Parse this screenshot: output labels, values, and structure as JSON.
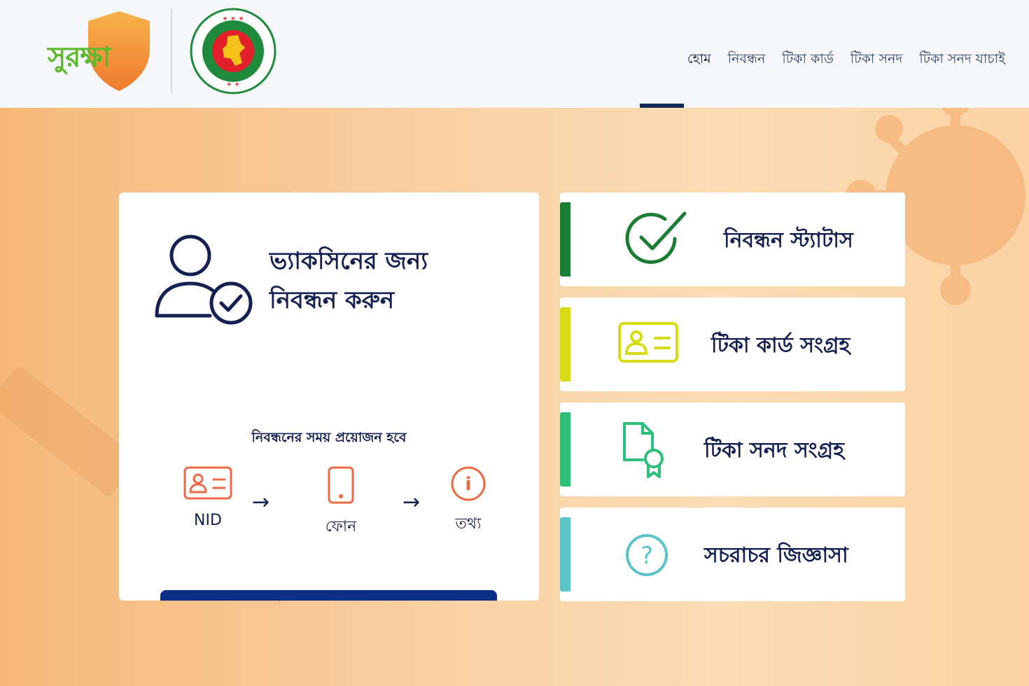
{
  "header": {
    "logo_text": "সুরক্ষা",
    "seal_alt": "গণপ্রজাতন্ত্রী বাংলাদেশ সরকার",
    "nav": [
      {
        "label": "হোম",
        "active": true
      },
      {
        "label": "নিবন্ধন"
      },
      {
        "label": "টিকা কার্ড"
      },
      {
        "label": "টিকা সনদ"
      },
      {
        "label": "টিকা সনদ যাচাই"
      }
    ]
  },
  "register_card": {
    "title_line1": "ভ্যাকসিনের জন্য",
    "title_line2": "নিবন্ধন করুন",
    "requirement_title": "নিবন্ধনের সময় প্রয়োজন হবে",
    "steps": [
      {
        "label": "NID",
        "icon": "id-card-icon"
      },
      {
        "label": "ফোন",
        "icon": "phone-icon"
      },
      {
        "label": "তথ্য",
        "icon": "info-icon"
      }
    ]
  },
  "side_cards": [
    {
      "label": "নিবন্ধন স্ট্যাটাস",
      "icon": "check-circle-icon",
      "accent": "#1b7d33"
    },
    {
      "label": "টিকা কার্ড সংগ্রহ",
      "icon": "id-card-icon",
      "accent": "#d7dc16"
    },
    {
      "label": "টিকা সনদ সংগ্রহ",
      "icon": "certificate-icon",
      "accent": "#2fbf7a"
    },
    {
      "label": "সচরাচর জিজ্ঞাসা",
      "icon": "question-circle-icon",
      "accent": "#5cc3c9"
    }
  ],
  "colors": {
    "primary": "#142052",
    "button": "#0e2f86",
    "step_icon": "#ec6a45"
  }
}
